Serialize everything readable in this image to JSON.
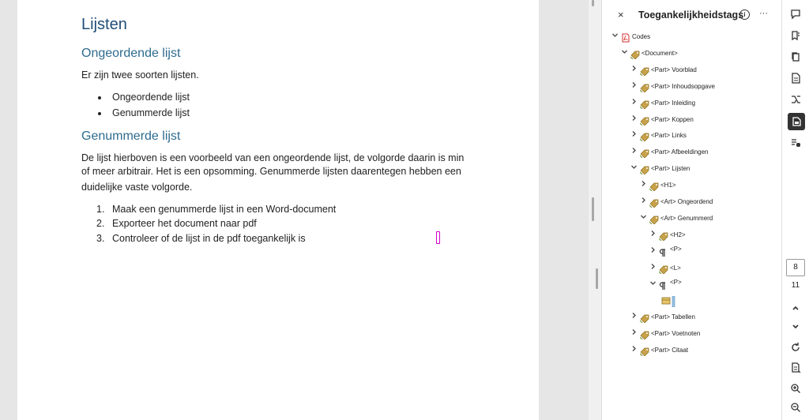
{
  "document": {
    "heading1": "Lijsten",
    "sec1_heading": "Ongeordende lijst",
    "sec1_para": "Er zijn twee soorten lijsten.",
    "bullets": [
      "Ongeordende lijst",
      "Genummerde lijst"
    ],
    "sec2_heading": "Genummerde lijst",
    "sec2_para_lines": [
      "De lijst hierboven is een voorbeeld van een ongeordende lijst, de volgorde daarin is min",
      "of meer arbitrair. Het is een opsomming. Genummerde lijsten daarentegen hebben een",
      "duidelijke vaste volgorde."
    ],
    "numbered": [
      {
        "num": "1.",
        "text": "Maak een genummerde lijst in een Word-document"
      },
      {
        "num": "2.",
        "text": "Exporteer het document naar pdf"
      },
      {
        "num": "3.",
        "text": "Controleer of de lijst in de pdf toegankelijk is"
      }
    ]
  },
  "tags_panel": {
    "close": "×",
    "title": "Toegankelijkheidstags",
    "info": "i",
    "more": "···",
    "tree": [
      {
        "level": 0,
        "chevron": "down",
        "icon": "pdf-file-icon",
        "label": "Codes"
      },
      {
        "level": 1,
        "chevron": "down",
        "icon": "tag-icon",
        "label": "<Document>"
      },
      {
        "level": 2,
        "chevron": "right",
        "icon": "tag-icon",
        "label": "<Part> Voorblad"
      },
      {
        "level": 2,
        "chevron": "right",
        "icon": "tag-icon",
        "label": "<Part> Inhoudsopgave"
      },
      {
        "level": 2,
        "chevron": "right",
        "icon": "tag-icon",
        "label": "<Part> Inleiding"
      },
      {
        "level": 2,
        "chevron": "right",
        "icon": "tag-icon",
        "label": "<Part> Koppen"
      },
      {
        "level": 2,
        "chevron": "right",
        "icon": "tag-icon",
        "label": "<Part> Links"
      },
      {
        "level": 2,
        "chevron": "right",
        "icon": "tag-icon",
        "label": "<Part> Afbeeldingen"
      },
      {
        "level": 2,
        "chevron": "down",
        "icon": "tag-icon",
        "label": "<Part> Lijsten"
      },
      {
        "level": 3,
        "chevron": "right",
        "icon": "tag-icon",
        "label": "<H1>"
      },
      {
        "level": 3,
        "chevron": "right",
        "icon": "tag-icon",
        "label": "<Art> Ongeordend"
      },
      {
        "level": 3,
        "chevron": "down",
        "icon": "tag-icon",
        "label": "<Art> Genummerd"
      },
      {
        "level": 4,
        "chevron": "right",
        "icon": "tag-icon",
        "label": "<H2>"
      },
      {
        "level": 4,
        "chevron": "right",
        "icon": "pilcrow-icon",
        "label": "<P>"
      },
      {
        "level": 4,
        "chevron": "right",
        "icon": "tag-icon",
        "label": "<L>"
      },
      {
        "level": 4,
        "chevron": "down",
        "icon": "pilcrow-icon",
        "label": "<P>"
      },
      {
        "level": 5,
        "chevron": "none",
        "icon": "content-container-icon",
        "label": ""
      },
      {
        "level": 2,
        "chevron": "right",
        "icon": "tag-icon",
        "label": "<Part> Tabellen"
      },
      {
        "level": 2,
        "chevron": "right",
        "icon": "tag-icon",
        "label": "<Part> Voetnoten"
      },
      {
        "level": 2,
        "chevron": "right",
        "icon": "tag-icon",
        "label": "<Part> Citaat"
      }
    ]
  },
  "toolbar": {
    "icons": [
      "comment-icon",
      "bookmark-icon",
      "pages-icon",
      "document-icon",
      "order-icon",
      "accessibility-tags-icon",
      "reading-order-icon"
    ],
    "current_page": "8",
    "page_count": "11",
    "bottom_icons": [
      "chevron-up-icon",
      "chevron-down-icon",
      "rotate-icon",
      "fit-page-icon",
      "zoom-in-icon",
      "zoom-out-icon"
    ]
  },
  "colors": {
    "heading": "#1f4e79",
    "subheading": "#2e6b8f",
    "tag_icon": "#c8a24a",
    "pdf_icon": "#d32f2f",
    "caret": "#d000c8"
  }
}
